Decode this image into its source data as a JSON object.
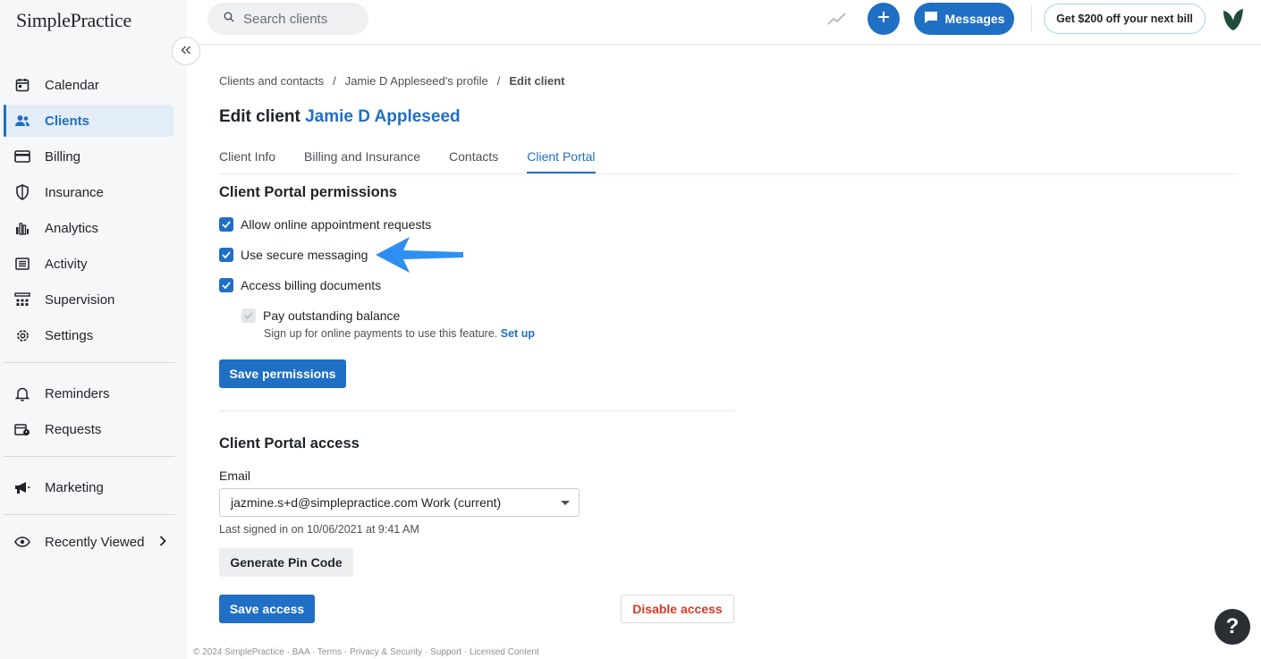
{
  "sidebar": {
    "logo": "SimplePractice",
    "collapse_icon": "double-chevron-left-icon",
    "items": [
      {
        "label": "Calendar",
        "icon": "calendar-icon"
      },
      {
        "label": "Clients",
        "icon": "users-icon",
        "active": true
      },
      {
        "label": "Billing",
        "icon": "credit-card-icon"
      },
      {
        "label": "Insurance",
        "icon": "shield-icon"
      },
      {
        "label": "Analytics",
        "icon": "bar-chart-icon"
      },
      {
        "label": "Activity",
        "icon": "list-icon"
      },
      {
        "label": "Supervision",
        "icon": "supervision-icon"
      },
      {
        "label": "Settings",
        "icon": "gear-icon"
      },
      {
        "label": "Reminders",
        "icon": "bell-icon"
      },
      {
        "label": "Requests",
        "icon": "requests-icon"
      },
      {
        "label": "Marketing",
        "icon": "megaphone-icon"
      },
      {
        "label": "Recently Viewed",
        "icon": "eye-icon"
      }
    ]
  },
  "topbar": {
    "search_placeholder": "Search clients",
    "messages_label": "Messages",
    "promo_label": "Get $200 off your next bill"
  },
  "breadcrumb": {
    "items": [
      "Clients and contacts",
      "Jamie D Appleseed's profile",
      "Edit client"
    ],
    "separator": "/"
  },
  "page": {
    "title_prefix": "Edit client",
    "client_name": "Jamie D Appleseed"
  },
  "tabs": [
    {
      "label": "Client Info"
    },
    {
      "label": "Billing and Insurance"
    },
    {
      "label": "Contacts"
    },
    {
      "label": "Client Portal",
      "active": true
    }
  ],
  "permissions": {
    "title": "Client Portal permissions",
    "options": [
      {
        "label": "Allow online appointment requests",
        "checked": true
      },
      {
        "label": "Use secure messaging",
        "checked": true
      },
      {
        "label": "Access billing documents",
        "checked": true
      },
      {
        "label": "Pay outstanding balance",
        "checked": true,
        "disabled": true
      }
    ],
    "hint": "Sign up for online payments to use this feature.",
    "hint_link": "Set up",
    "save_label": "Save permissions"
  },
  "access": {
    "title": "Client Portal access",
    "email_label": "Email",
    "email_value": "jazmine.s+d@simplepractice.com Work (current)",
    "last_signed": "Last signed in on 10/06/2021 at 9:41 AM",
    "generate_pin_label": "Generate Pin Code",
    "save_access_label": "Save access",
    "disable_access_label": "Disable access"
  },
  "footer": "© 2024 SimplePractice · BAA · Terms · Privacy & Security · Support · Licensed Content",
  "help_label": "?",
  "colors": {
    "accent": "#1f6fc5",
    "danger": "#d93a26",
    "sidebar_bg": "#f6f7f8",
    "arrow": "#2f8ff0"
  }
}
